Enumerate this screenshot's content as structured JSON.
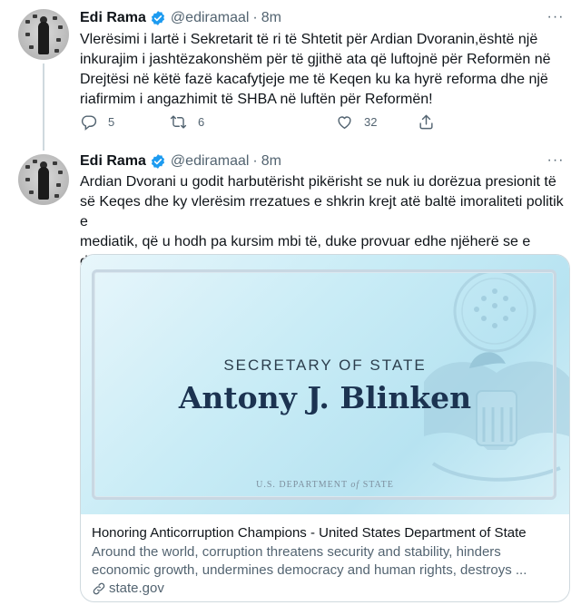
{
  "tweets": [
    {
      "author": {
        "name": "Edi Rama",
        "handle": "@ediramaal",
        "verified": true
      },
      "separator": "·",
      "time": "8m",
      "text": "Vlerësimi i lartë i Sekretarit të ri të Shtetit për Ardian Dvoranin,është një\ninkurajim i jashtëzakonshëm për të gjithë ata që luftojnë për Reformën në\nDrejtësi në këtë fazë kacafytjeje me të Keqen ku ka hyrë reforma dhe një\nriafirmim i angazhimit të SHBA në luftën për Reformën!",
      "actions": {
        "replies": "5",
        "retweets": "6",
        "likes": "32"
      },
      "more": "···"
    },
    {
      "author": {
        "name": "Edi Rama",
        "handle": "@ediramaal",
        "verified": true
      },
      "separator": "·",
      "time": "8m",
      "text": "Ardian Dvorani u godit harbutërisht pikërisht se nuk iu dorëzua presionit të\nsë Keqes dhe ky vlerësim rrezatues e shkrin krejt atë baltë imoraliteti politik e\nmediatik, që u hodh pa kursim mbi të, duke provuar edhe njëherë se e drejta\nvonon po nuk harron",
      "more": "···",
      "card": {
        "image_heading": "SECRETARY OF STATE",
        "image_name": "Antony J. Blinken",
        "image_footer_a": "U.S. DEPARTMENT",
        "image_footer_of": "of",
        "image_footer_b": "STATE",
        "title": "Honoring Anticorruption Champions - United States Department of State",
        "description": "Around the world, corruption threatens security and stability, hinders economic growth, undermines democracy and human rights, destroys ...",
        "domain": "state.gov"
      }
    }
  ],
  "colors": {
    "text_primary": "#0f1419",
    "text_secondary": "#536471",
    "verified_blue": "#1d9bf0",
    "border": "#cfd9de"
  },
  "icons": [
    "verified-badge-icon",
    "more-icon",
    "reply-icon",
    "retweet-icon",
    "like-icon",
    "link-icon",
    "seal-icon"
  ]
}
